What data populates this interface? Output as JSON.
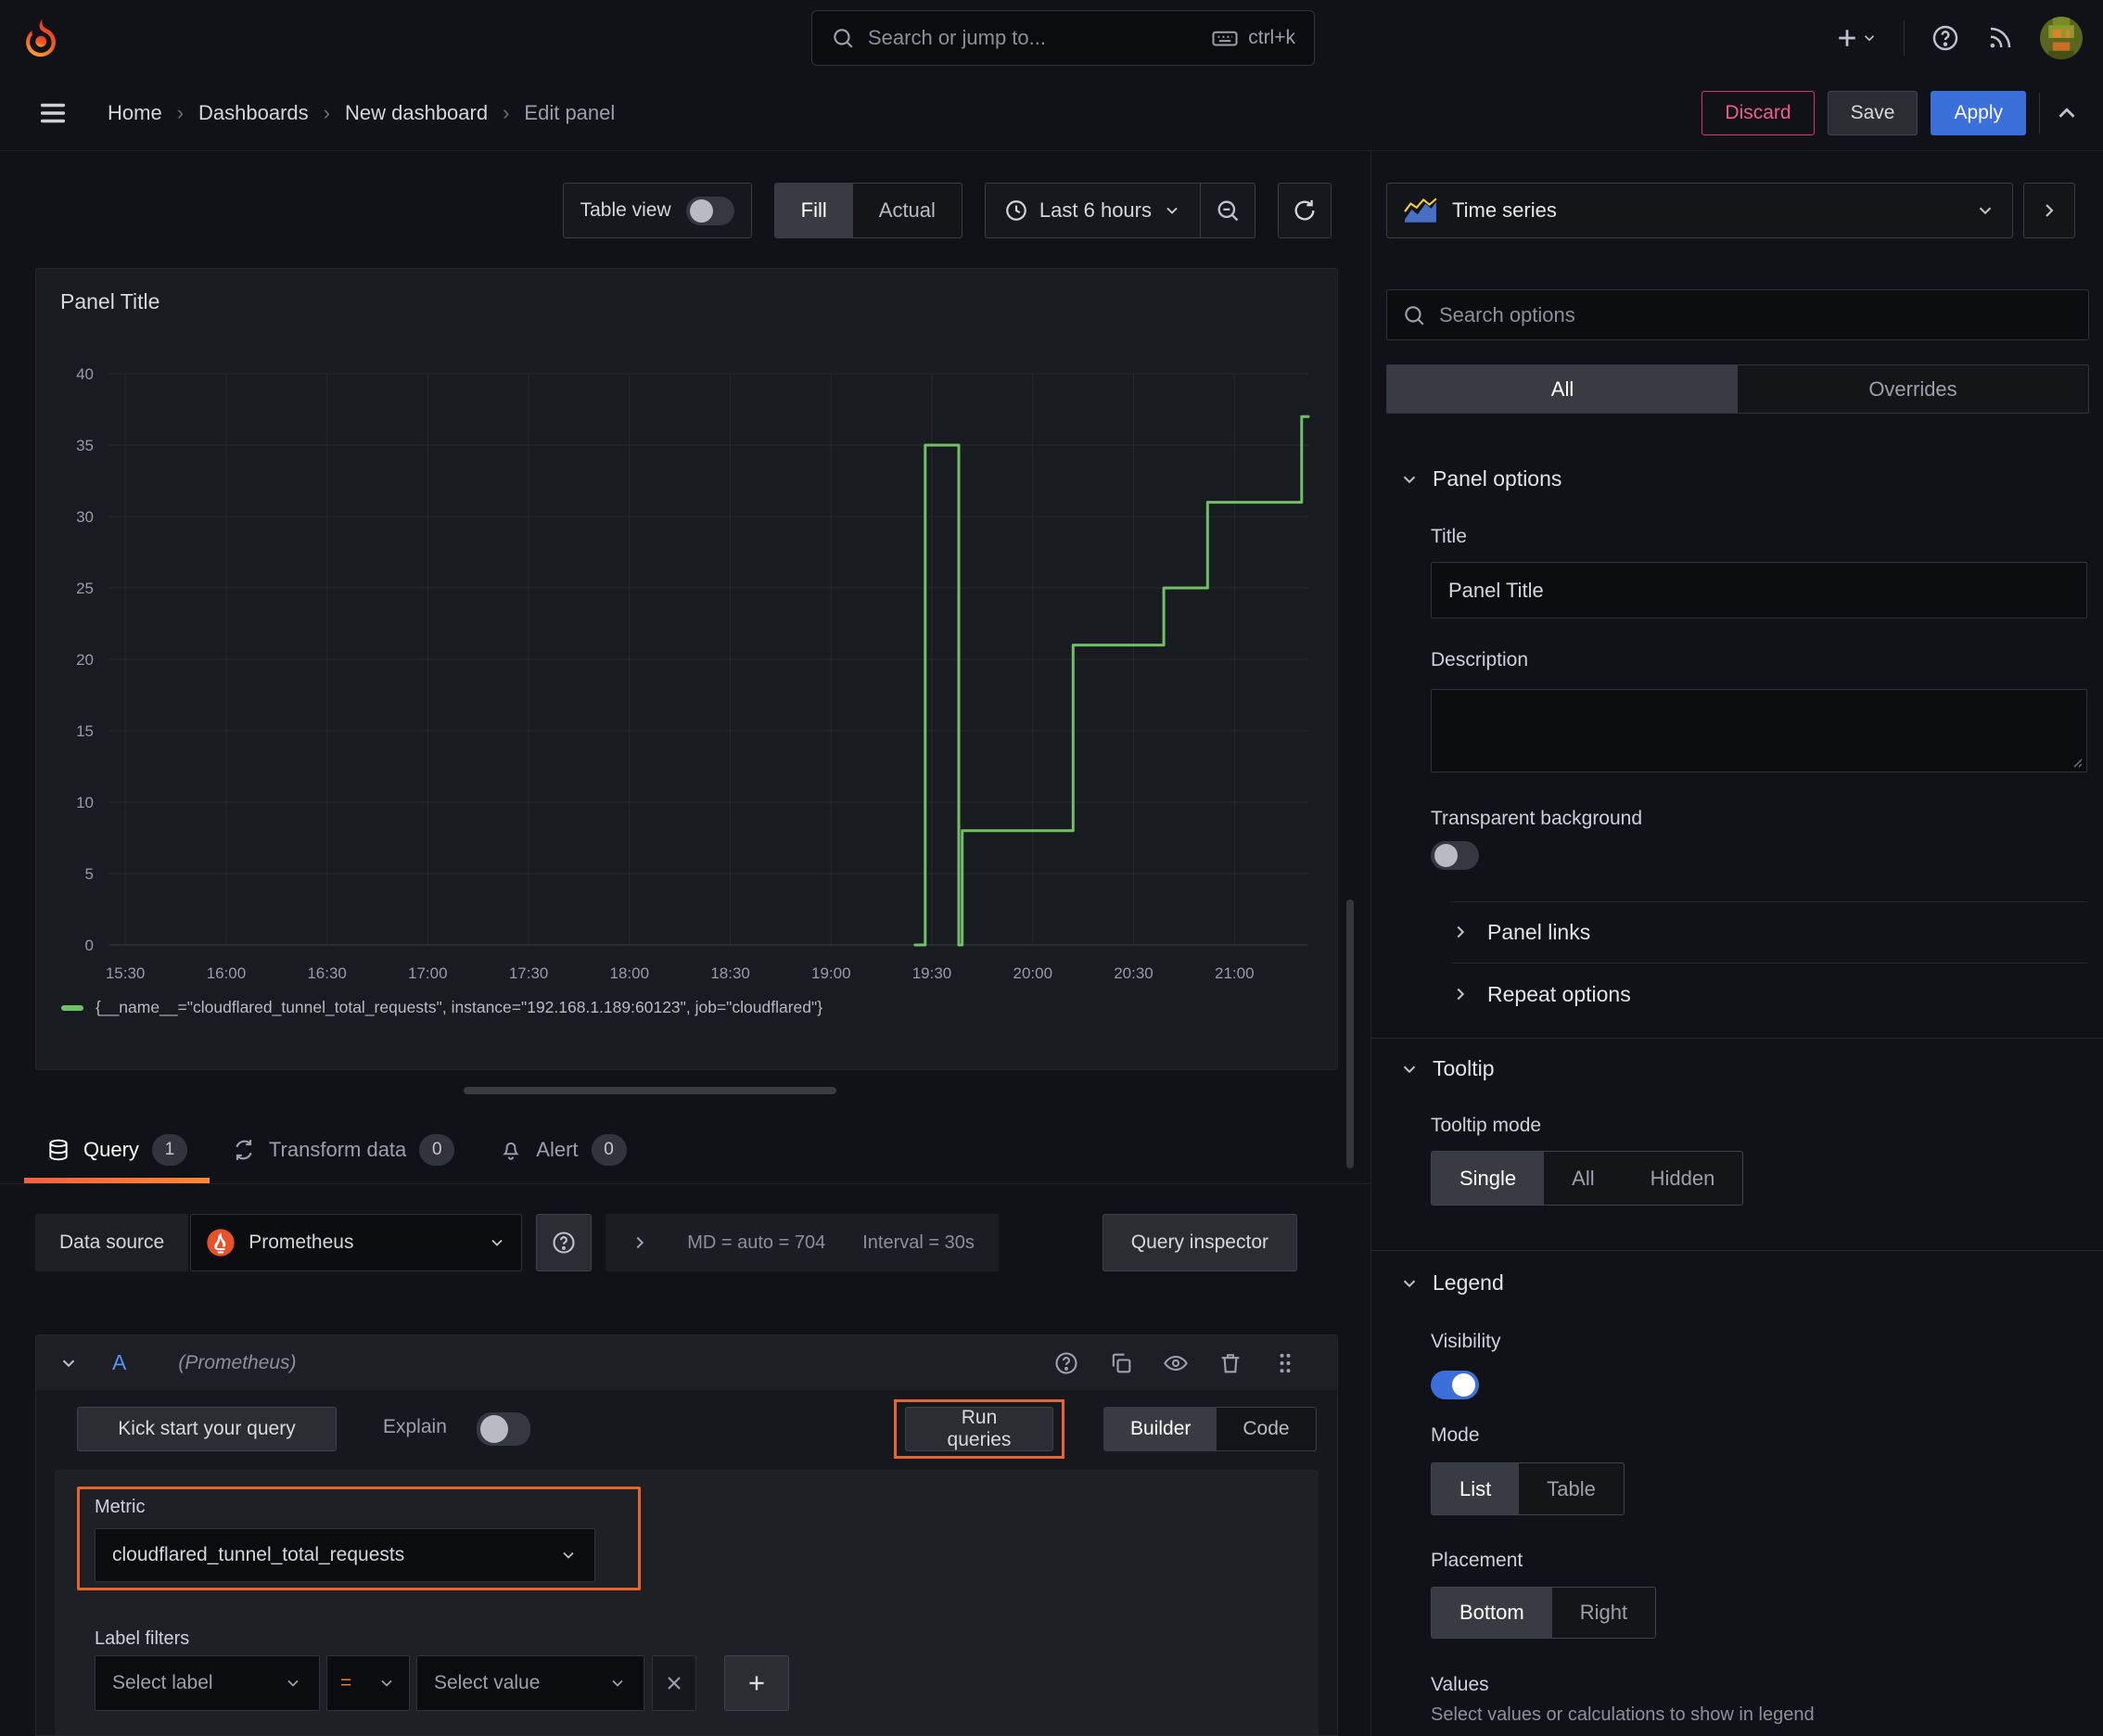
{
  "topbar": {
    "search_placeholder": "Search or jump to...",
    "shortcut": "ctrl+k"
  },
  "breadcrumb": {
    "items": [
      "Home",
      "Dashboards",
      "New dashboard",
      "Edit panel"
    ]
  },
  "header_actions": {
    "discard": "Discard",
    "save": "Save",
    "apply": "Apply"
  },
  "toolbar": {
    "table_view": "Table view",
    "fill": "Fill",
    "actual": "Actual",
    "time_range": "Last 6 hours"
  },
  "panel": {
    "title": "Panel Title"
  },
  "chart_data": {
    "type": "line",
    "title": "Panel Title",
    "x_ticks": [
      "15:30",
      "16:00",
      "16:30",
      "17:00",
      "17:30",
      "18:00",
      "18:30",
      "19:00",
      "19:30",
      "20:00",
      "20:30",
      "21:00"
    ],
    "y_ticks": [
      0,
      5,
      10,
      15,
      20,
      25,
      30,
      35,
      40
    ],
    "ylim": [
      0,
      40
    ],
    "x_range": [
      "15:25",
      "21:22"
    ],
    "grid": true,
    "legend_position": "bottom",
    "series": [
      {
        "name": "{__name__=\"cloudflared_tunnel_total_requests\", instance=\"192.168.1.189:60123\", job=\"cloudflared\"}",
        "color": "#73bf69",
        "points": [
          [
            "19:25",
            0
          ],
          [
            "19:28",
            0
          ],
          [
            "19:28",
            35
          ],
          [
            "19:38",
            35
          ],
          [
            "19:38",
            0
          ],
          [
            "19:39",
            0
          ],
          [
            "19:39",
            8
          ],
          [
            "20:12",
            8
          ],
          [
            "20:12",
            21
          ],
          [
            "20:39",
            21
          ],
          [
            "20:39",
            25
          ],
          [
            "20:52",
            25
          ],
          [
            "20:52",
            31
          ],
          [
            "21:20",
            31
          ],
          [
            "21:20",
            37
          ],
          [
            "21:22",
            37
          ]
        ]
      }
    ]
  },
  "tabs": {
    "query": "Query",
    "query_count": "1",
    "transform": "Transform data",
    "transform_count": "0",
    "alert": "Alert",
    "alert_count": "0"
  },
  "datasource": {
    "label": "Data source",
    "name": "Prometheus",
    "stats_md": "MD = auto = 704",
    "stats_interval": "Interval = 30s",
    "query_inspector": "Query inspector"
  },
  "query": {
    "ref_id": "A",
    "ds_hint": "(Prometheus)",
    "kick_start": "Kick start your query",
    "explain": "Explain",
    "run_queries": "Run queries",
    "builder": "Builder",
    "code": "Code",
    "metric_label": "Metric",
    "metric_value": "cloudflared_tunnel_total_requests",
    "label_filters_label": "Label filters",
    "select_label_placeholder": "Select label",
    "operator": "=",
    "select_value_placeholder": "Select value"
  },
  "sidebar": {
    "viz_name": "Time series",
    "search_placeholder": "Search options",
    "tab_all": "All",
    "tab_overrides": "Overrides",
    "panel_options": {
      "title": "Panel options",
      "title_label": "Title",
      "title_value": "Panel Title",
      "description_label": "Description",
      "transparent_label": "Transparent background"
    },
    "panel_links": "Panel links",
    "repeat_options": "Repeat options",
    "tooltip": {
      "title": "Tooltip",
      "mode_label": "Tooltip mode",
      "modes": [
        "Single",
        "All",
        "Hidden"
      ]
    },
    "legend": {
      "title": "Legend",
      "visibility_label": "Visibility",
      "mode_label": "Mode",
      "modes": [
        "List",
        "Table"
      ],
      "placement_label": "Placement",
      "placements": [
        "Bottom",
        "Right"
      ],
      "values_label": "Values",
      "values_hint": "Select values or calculations to show in legend"
    }
  },
  "colors": {
    "background": "#111217",
    "panel_bg": "#181b1f",
    "accent_orange_highlight": "#e8642c",
    "series_green": "#73bf69",
    "primary_blue": "#3b6fd9",
    "destructive_pink": "#e0356c",
    "tab_underline_gradient": [
      "#f55f3e",
      "#ff8833"
    ],
    "prometheus_orange": "#e6522c"
  },
  "icons": [
    "grafana-logo",
    "search",
    "keyboard",
    "plus",
    "chevron-down",
    "help-circle",
    "rss",
    "avatar",
    "menu",
    "chevron-up",
    "clock",
    "zoom-out",
    "refresh",
    "time-series",
    "database",
    "transform",
    "bell",
    "copy",
    "eye",
    "trash",
    "drag-handle",
    "close",
    "magnifier",
    "resize-corner",
    "chevron-right",
    "prometheus-flame"
  ]
}
